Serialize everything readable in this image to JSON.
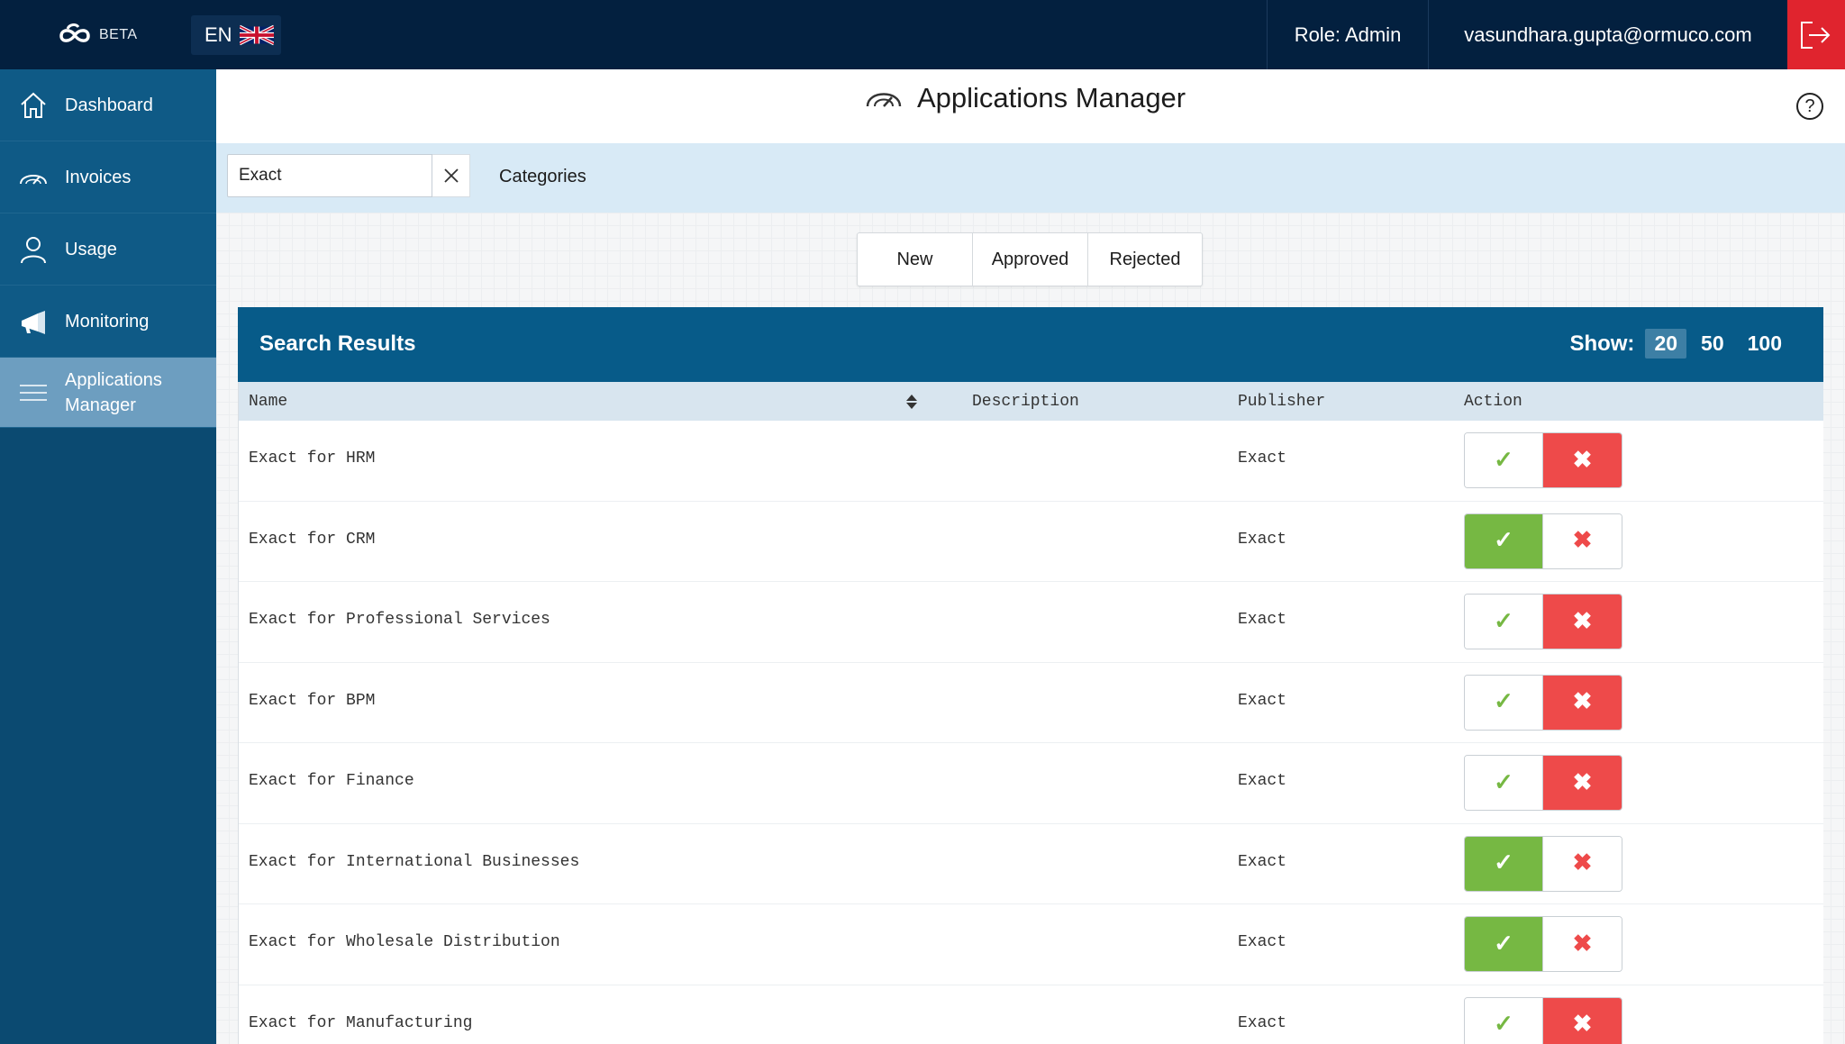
{
  "topbar": {
    "beta_label": "BETA",
    "language_code": "EN",
    "role": "Role: Admin",
    "email": "vasundhara.gupta@ormuco.com",
    "logout_icon": "logout-icon"
  },
  "sidebar": {
    "items": [
      {
        "label": "Dashboard",
        "icon": "home-icon"
      },
      {
        "label": "Invoices",
        "icon": "gauge-icon"
      },
      {
        "label": "Usage",
        "icon": "user-icon"
      },
      {
        "label": "Monitoring",
        "icon": "megaphone-icon"
      },
      {
        "label": "Applications Manager",
        "icon": "menu-icon",
        "active": true
      }
    ]
  },
  "header": {
    "title": "Applications Manager",
    "help_icon": "?"
  },
  "filter": {
    "search_value": "Exact",
    "categories_label": "Categories"
  },
  "status_tabs": [
    "New",
    "Approved",
    "Rejected"
  ],
  "results": {
    "title": "Search Results",
    "show_label": "Show:",
    "show_options": [
      "20",
      "50",
      "100"
    ],
    "show_selected": "20",
    "columns": [
      "Name",
      "Description",
      "Publisher",
      "Action"
    ],
    "rows": [
      {
        "name": "Exact for HRM",
        "description": "",
        "publisher": "Exact",
        "state": "rejected"
      },
      {
        "name": "Exact for CRM",
        "description": "",
        "publisher": "Exact",
        "state": "approved"
      },
      {
        "name": "Exact for Professional Services",
        "description": "",
        "publisher": "Exact",
        "state": "rejected"
      },
      {
        "name": "Exact for BPM",
        "description": "",
        "publisher": "Exact",
        "state": "rejected"
      },
      {
        "name": "Exact for Finance",
        "description": "",
        "publisher": "Exact",
        "state": "rejected"
      },
      {
        "name": "Exact for International Businesses",
        "description": "",
        "publisher": "Exact",
        "state": "approved"
      },
      {
        "name": "Exact for Wholesale Distribution",
        "description": "",
        "publisher": "Exact",
        "state": "approved"
      },
      {
        "name": "Exact for Manufacturing",
        "description": "",
        "publisher": "Exact",
        "state": "rejected"
      }
    ],
    "approve_glyph": "✓",
    "reject_glyph": "✖"
  },
  "colors": {
    "topbar": "#03203f",
    "sidebar": "#0b4a71",
    "sidebar_active": "#6d9ec0",
    "results_header": "#075b89",
    "approve_active": "#76b843",
    "reject_active": "#ee4a4a",
    "logout": "#e0242e"
  }
}
